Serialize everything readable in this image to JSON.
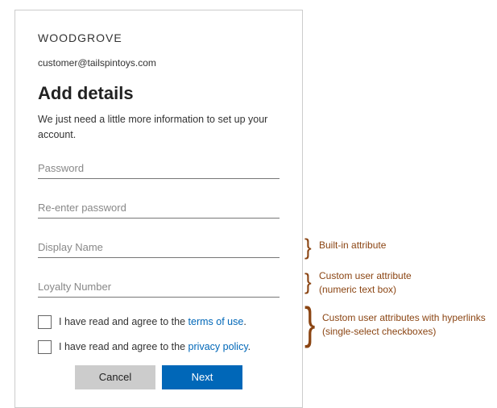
{
  "brand": "WOODGROVE",
  "email": "customer@tailspintoys.com",
  "title": "Add details",
  "subtitle": "We just need a little more information to set up your account.",
  "fields": {
    "password_placeholder": "Password",
    "reenter_placeholder": "Re-enter password",
    "display_name_placeholder": "Display Name",
    "loyalty_placeholder": "Loyalty Number"
  },
  "consents": {
    "terms_prefix": "I have read and agree to the ",
    "terms_link": "terms of use",
    "terms_suffix": ".",
    "privacy_prefix": "I have read and agree to the ",
    "privacy_link": "privacy policy",
    "privacy_suffix": "."
  },
  "buttons": {
    "cancel": "Cancel",
    "next": "Next"
  },
  "annotations": {
    "builtin": "Built-in attribute",
    "custom_numeric_l1": "Custom user attribute",
    "custom_numeric_l2": "(numeric text box)",
    "custom_checks_l1": "Custom user attributes with hyperlinks",
    "custom_checks_l2": "(single-select checkboxes)"
  }
}
